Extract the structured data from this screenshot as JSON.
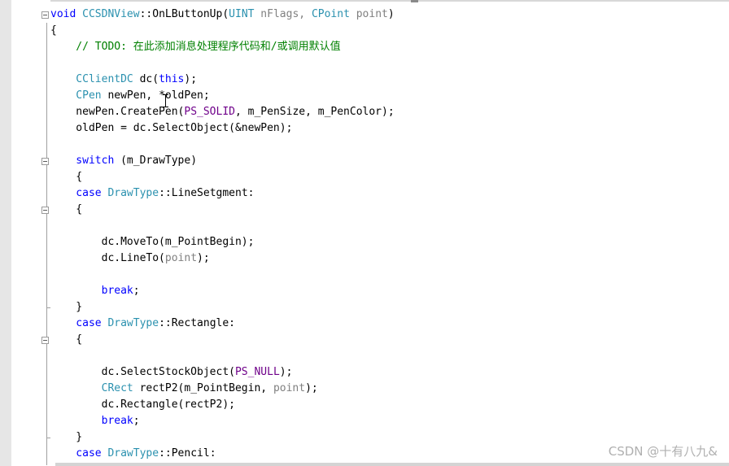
{
  "editor": {
    "lines": [
      [
        {
          "c": "kw",
          "t": "void "
        },
        {
          "c": "ty",
          "t": "CCSDNView"
        },
        {
          "c": "fn",
          "t": "::OnLButtonUp("
        },
        {
          "c": "ty",
          "t": "UINT"
        },
        {
          "c": "param",
          "t": " nFlags, "
        },
        {
          "c": "ty",
          "t": "CPoint"
        },
        {
          "c": "param",
          "t": " point"
        },
        {
          "c": "fn",
          "t": ")"
        }
      ],
      [
        {
          "c": "fn",
          "t": "{"
        }
      ],
      [
        {
          "c": "cm",
          "t": "    // TODO: 在此添加消息处理程序代码和/或调用默认值"
        }
      ],
      [],
      [
        {
          "c": "ty",
          "t": "    CClientDC"
        },
        {
          "c": "fn",
          "t": " dc("
        },
        {
          "c": "kw",
          "t": "this"
        },
        {
          "c": "fn",
          "t": ");"
        }
      ],
      [
        {
          "c": "ty",
          "t": "    CPen"
        },
        {
          "c": "fn",
          "t": " newPen, *oldPen;"
        }
      ],
      [
        {
          "c": "fn",
          "t": "    newPen.CreatePen("
        },
        {
          "c": "macro",
          "t": "PS_SOLID"
        },
        {
          "c": "fn",
          "t": ", m_PenSize, m_PenColor);"
        }
      ],
      [
        {
          "c": "fn",
          "t": "    oldPen = dc.SelectObject(&newPen);"
        }
      ],
      [],
      [
        {
          "c": "kw",
          "t": "    switch"
        },
        {
          "c": "fn",
          "t": " (m_DrawType)"
        }
      ],
      [
        {
          "c": "fn",
          "t": "    {"
        }
      ],
      [
        {
          "c": "kw",
          "t": "    case "
        },
        {
          "c": "ty",
          "t": "DrawType"
        },
        {
          "c": "fn",
          "t": "::LineSetgment:"
        }
      ],
      [
        {
          "c": "fn",
          "t": "    {"
        }
      ],
      [],
      [
        {
          "c": "fn",
          "t": "        dc.MoveTo(m_PointBegin);"
        }
      ],
      [
        {
          "c": "fn",
          "t": "        dc.LineTo("
        },
        {
          "c": "param",
          "t": "point"
        },
        {
          "c": "fn",
          "t": ");"
        }
      ],
      [],
      [
        {
          "c": "kw",
          "t": "        break"
        },
        {
          "c": "fn",
          "t": ";"
        }
      ],
      [
        {
          "c": "fn",
          "t": "    }"
        }
      ],
      [
        {
          "c": "kw",
          "t": "    case "
        },
        {
          "c": "ty",
          "t": "DrawType"
        },
        {
          "c": "fn",
          "t": "::Rectangle:"
        }
      ],
      [
        {
          "c": "fn",
          "t": "    {"
        }
      ],
      [],
      [
        {
          "c": "fn",
          "t": "        dc.SelectStockObject("
        },
        {
          "c": "macro",
          "t": "PS_NULL"
        },
        {
          "c": "fn",
          "t": ");"
        }
      ],
      [
        {
          "c": "ty",
          "t": "        CRect"
        },
        {
          "c": "fn",
          "t": " rectP2(m_PointBegin, "
        },
        {
          "c": "param",
          "t": "point"
        },
        {
          "c": "fn",
          "t": ");"
        }
      ],
      [
        {
          "c": "fn",
          "t": "        dc.Rectangle(rectP2);"
        }
      ],
      [
        {
          "c": "kw",
          "t": "        break"
        },
        {
          "c": "fn",
          "t": ";"
        }
      ],
      [
        {
          "c": "fn",
          "t": "    }"
        }
      ],
      [
        {
          "c": "kw",
          "t": "    case "
        },
        {
          "c": "ty",
          "t": "DrawType"
        },
        {
          "c": "fn",
          "t": "::Pencil:"
        }
      ]
    ],
    "fold_toggle_lines": [
      0,
      9,
      12,
      20
    ],
    "fold_tick_lines": [
      18,
      26
    ],
    "icons": {
      "fold": "collapse-minus-icon",
      "cursor": "text-ibeam-cursor-icon"
    }
  },
  "colors": {
    "keyword": "#0000ff",
    "type": "#2b91af",
    "parameter": "#808080",
    "macro": "#6f008a",
    "comment": "#008000"
  },
  "watermark": "CSDN @十有八九&"
}
